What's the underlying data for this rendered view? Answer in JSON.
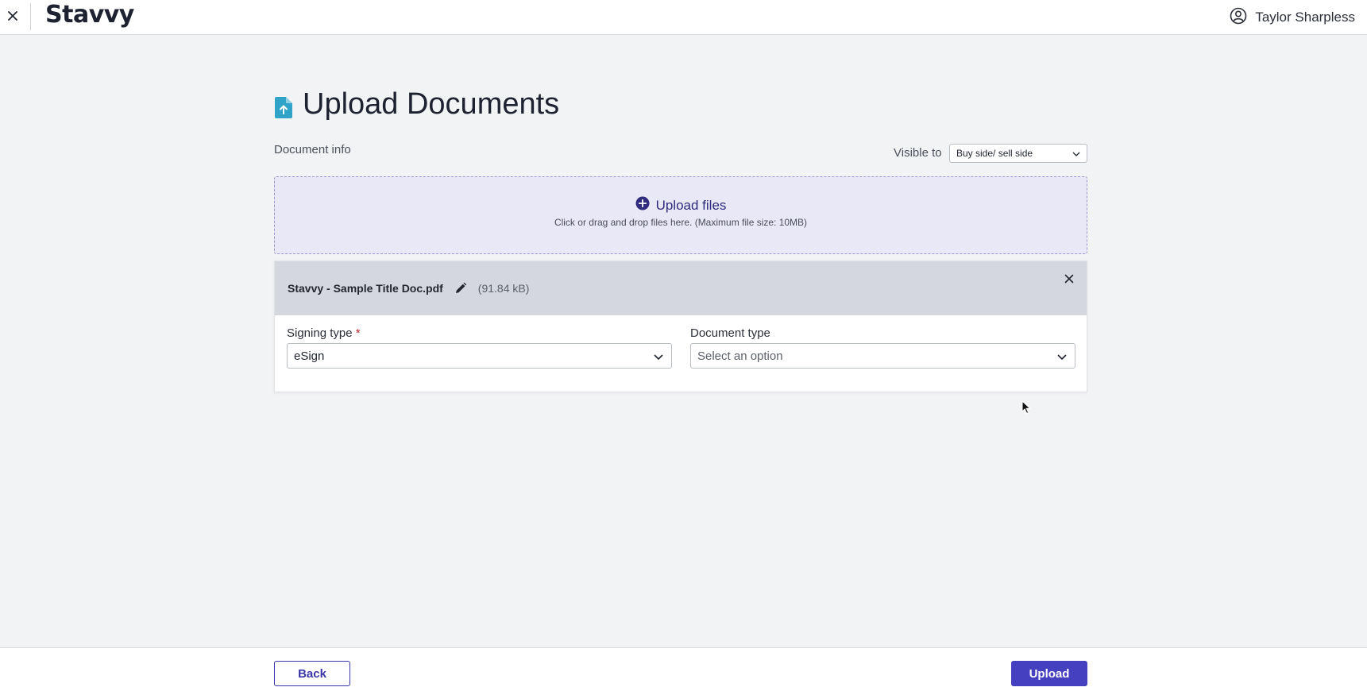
{
  "app": {
    "logo": "Stavvy"
  },
  "user": {
    "name": "Taylor Sharpless",
    "icon": "user-circle-icon"
  },
  "page": {
    "title": "Upload Documents",
    "icon": "file-upload-icon",
    "doc_info_label": "Document info"
  },
  "visibility": {
    "label": "Visible to",
    "selected": "Buy side/ sell side"
  },
  "dropzone": {
    "icon": "plus-circle-icon",
    "title": "Upload files",
    "hint": "Click or drag and drop files here. (Maximum file size: 10MB)"
  },
  "file": {
    "name": "Stavvy - Sample Title Doc.pdf",
    "size": "(91.84 kB)",
    "signing_type": {
      "label": "Signing type",
      "required_mark": "*",
      "value": "eSign"
    },
    "document_type": {
      "label": "Document type",
      "placeholder": "Select an option"
    }
  },
  "footer": {
    "back_label": "Back",
    "upload_label": "Upload"
  },
  "colors": {
    "accent": "#4540c0",
    "dropzone_bg": "#e9e8f6",
    "page_icon": "#2fa3c8"
  }
}
